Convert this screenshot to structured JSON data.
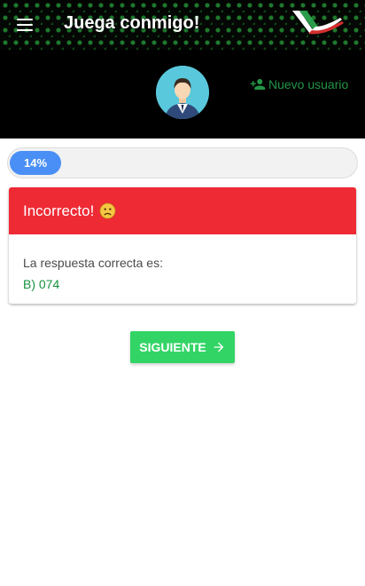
{
  "appbar": {
    "title": "Juega conmigo!",
    "menu_icon": "menu-icon",
    "logo_icon": "brand-logo",
    "logo_colors": [
      "#2a9d4a",
      "#ffffff",
      "#d32f2f"
    ]
  },
  "profile": {
    "avatar_icon": "user-avatar",
    "new_user_label": "Nuevo usuario",
    "new_user_icon": "person-add-icon"
  },
  "progress": {
    "label": "14%",
    "fraction": 0.14,
    "color": "#4a8ff5"
  },
  "result": {
    "title": "Incorrecto!",
    "emoji_icon": "sad-face-icon",
    "header_color": "#ee2a35",
    "answer_label": "La respuesta correcta es:",
    "answer_value": "B) 074",
    "answer_color": "#16923c"
  },
  "next_button": {
    "label": "SIGUIENTE",
    "icon": "arrow-right-icon",
    "color": "#33d466"
  }
}
